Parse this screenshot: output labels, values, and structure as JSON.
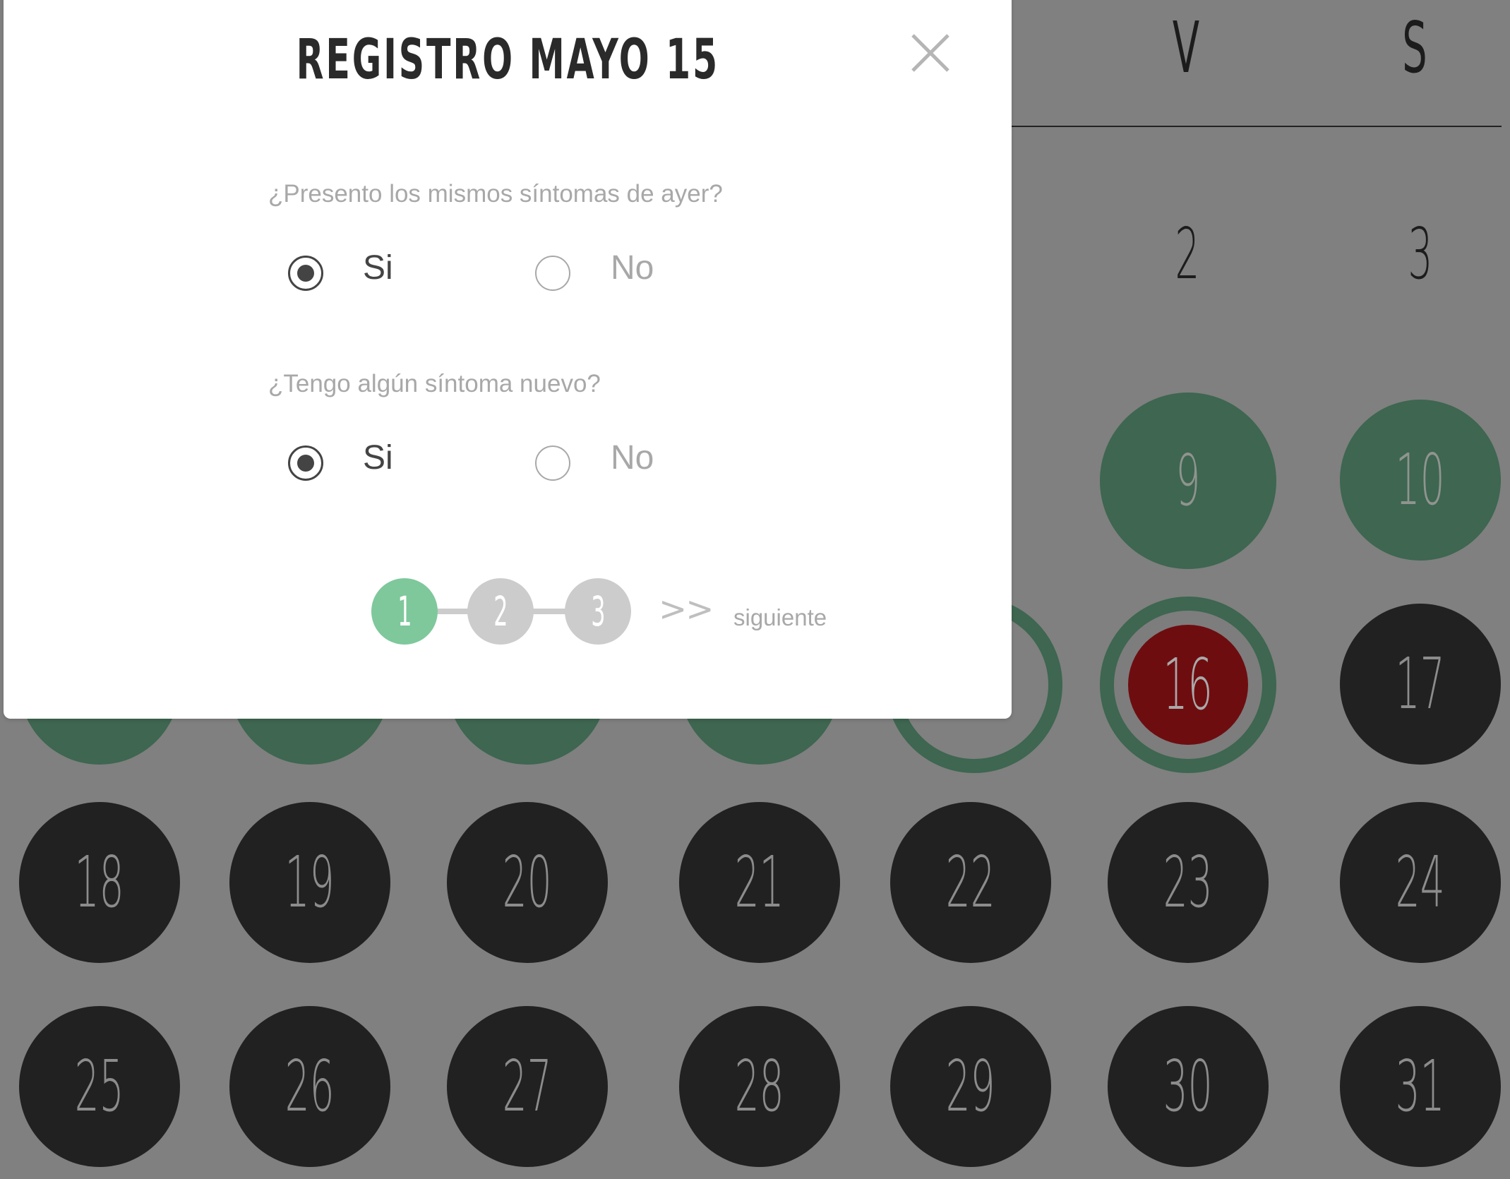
{
  "calendar": {
    "weekdays": [
      "V",
      "S"
    ],
    "days": {
      "d2": "2",
      "d3": "3",
      "d9": "9",
      "d10": "10",
      "d16": "16",
      "d17": "17",
      "d18": "18",
      "d19": "19",
      "d20": "20",
      "d21": "21",
      "d22": "22",
      "d23": "23",
      "d24": "24",
      "d25": "25",
      "d26": "26",
      "d27": "27",
      "d28": "28",
      "d29": "29",
      "d30": "30",
      "d31": "31"
    },
    "colors": {
      "background": "#808080",
      "logged_day": "#3e6650",
      "future_day": "#212121",
      "today_marker": "#6e0d10"
    }
  },
  "modal": {
    "title": "REGISTRO MAYO 15",
    "close_icon": "close-icon",
    "questions": [
      {
        "text": "¿Presento los mismos síntomas de ayer?",
        "options": [
          "Si",
          "No"
        ],
        "selected": "Si"
      },
      {
        "text": "¿Tengo algún síntoma nuevo?",
        "options": [
          "Si",
          "No"
        ],
        "selected": "Si"
      }
    ],
    "stepper": {
      "steps": [
        "1",
        "2",
        "3"
      ],
      "current": "1",
      "next_arrows": ">>",
      "next_label": "siguiente"
    },
    "colors": {
      "step_active": "#7ec89c",
      "step_inactive": "#cccccc"
    }
  }
}
